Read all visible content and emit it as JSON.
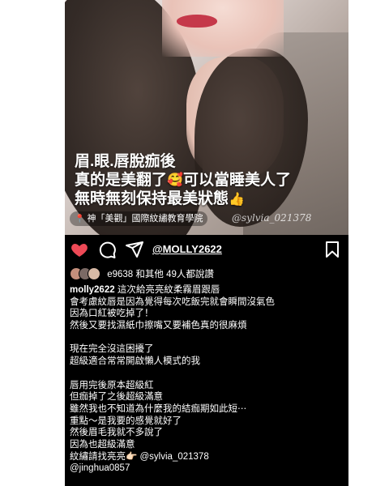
{
  "post": {
    "overlay_lines": [
      "眉.眼.唇脫痂後",
      "真的是美翻了",
      "可以當睡美人了",
      "無時無刻保持最美狀態"
    ],
    "location": "神「美觀」國際紋繡教育學院",
    "watermark": "@sylvia_021378",
    "mention": "@MOLLY2622",
    "likes_text": "e9638 和其他 49人都說讚",
    "caption": {
      "username": "molly2622",
      "first_line": " 這次給亮亮紋柔霧眉跟唇",
      "lines": [
        "會考慮紋唇是因為覺得每次吃飯完就會瞬間沒氣色",
        "因為口紅被吃掉了！",
        "然後又要找濕紙巾擦嘴又要補色真的很麻煩",
        "",
        "現在完全沒這困擾了",
        "超級適合常常開啟懶人模式的我",
        "",
        "唇用完後原本超級紅",
        "但痂掉了之後超級滿意",
        "雖然我也不知道為什麼我的結痂期如此短⋯",
        "重點～是我要的感覺就好了",
        "然後眉毛我就不多說了",
        "因為也超級滿意",
        "紋繡請找亮亮👉🏻 @sylvia_021378",
        "@jinghua0857"
      ]
    }
  },
  "icons": {
    "like": "heart-icon",
    "comment": "comment-icon",
    "share": "send-icon",
    "save": "bookmark-icon",
    "location": "location-pin-icon"
  },
  "colors": {
    "like": "#ed4956",
    "background": "#000000",
    "text": "#ffffff"
  }
}
